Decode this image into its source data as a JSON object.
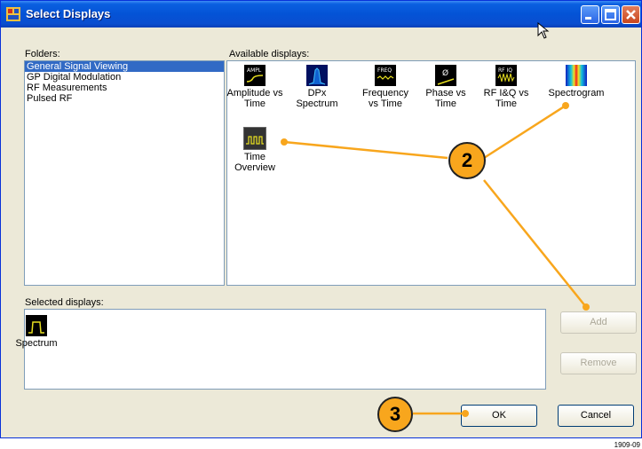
{
  "window": {
    "title": "Select Displays"
  },
  "folders": {
    "label": "Folders:",
    "items": [
      {
        "label": "General Signal Viewing",
        "selected": true
      },
      {
        "label": "GP Digital Modulation",
        "selected": false
      },
      {
        "label": "RF Measurements",
        "selected": false
      },
      {
        "label": "Pulsed RF",
        "selected": false
      }
    ]
  },
  "available": {
    "label": "Available displays:",
    "items": [
      {
        "label_line1": "Amplitude vs",
        "label_line2": "Time",
        "icon": "amplitude-vs-time-icon",
        "badge": "AMPL"
      },
      {
        "label_line1": "DPx",
        "label_line2": "Spectrum",
        "icon": "dpx-spectrum-icon",
        "badge": ""
      },
      {
        "label_line1": "Frequency",
        "label_line2": "vs Time",
        "icon": "frequency-vs-time-icon",
        "badge": "FREQ"
      },
      {
        "label_line1": "Phase vs",
        "label_line2": "Time",
        "icon": "phase-vs-time-icon",
        "badge": "Ø"
      },
      {
        "label_line1": "RF I&Q vs",
        "label_line2": "Time",
        "icon": "rf-iq-vs-time-icon",
        "badge": "RF IQ"
      },
      {
        "label_line1": "Spectrogram",
        "label_line2": "",
        "icon": "spectrogram-icon",
        "badge": ""
      },
      {
        "label_line1": "Time",
        "label_line2": "Overview",
        "icon": "time-overview-icon",
        "badge": ""
      }
    ]
  },
  "selected": {
    "label": "Selected displays:",
    "items": [
      {
        "label": "Spectrum",
        "icon": "spectrum-icon"
      }
    ]
  },
  "buttons": {
    "add": "Add",
    "remove": "Remove",
    "ok": "OK",
    "cancel": "Cancel"
  },
  "callouts": {
    "two": "2",
    "three": "3"
  },
  "figure_id": "1909-09",
  "colors": {
    "callout": "#f8a61d",
    "selection": "#316ac5",
    "titlebar": "#0453d6"
  }
}
